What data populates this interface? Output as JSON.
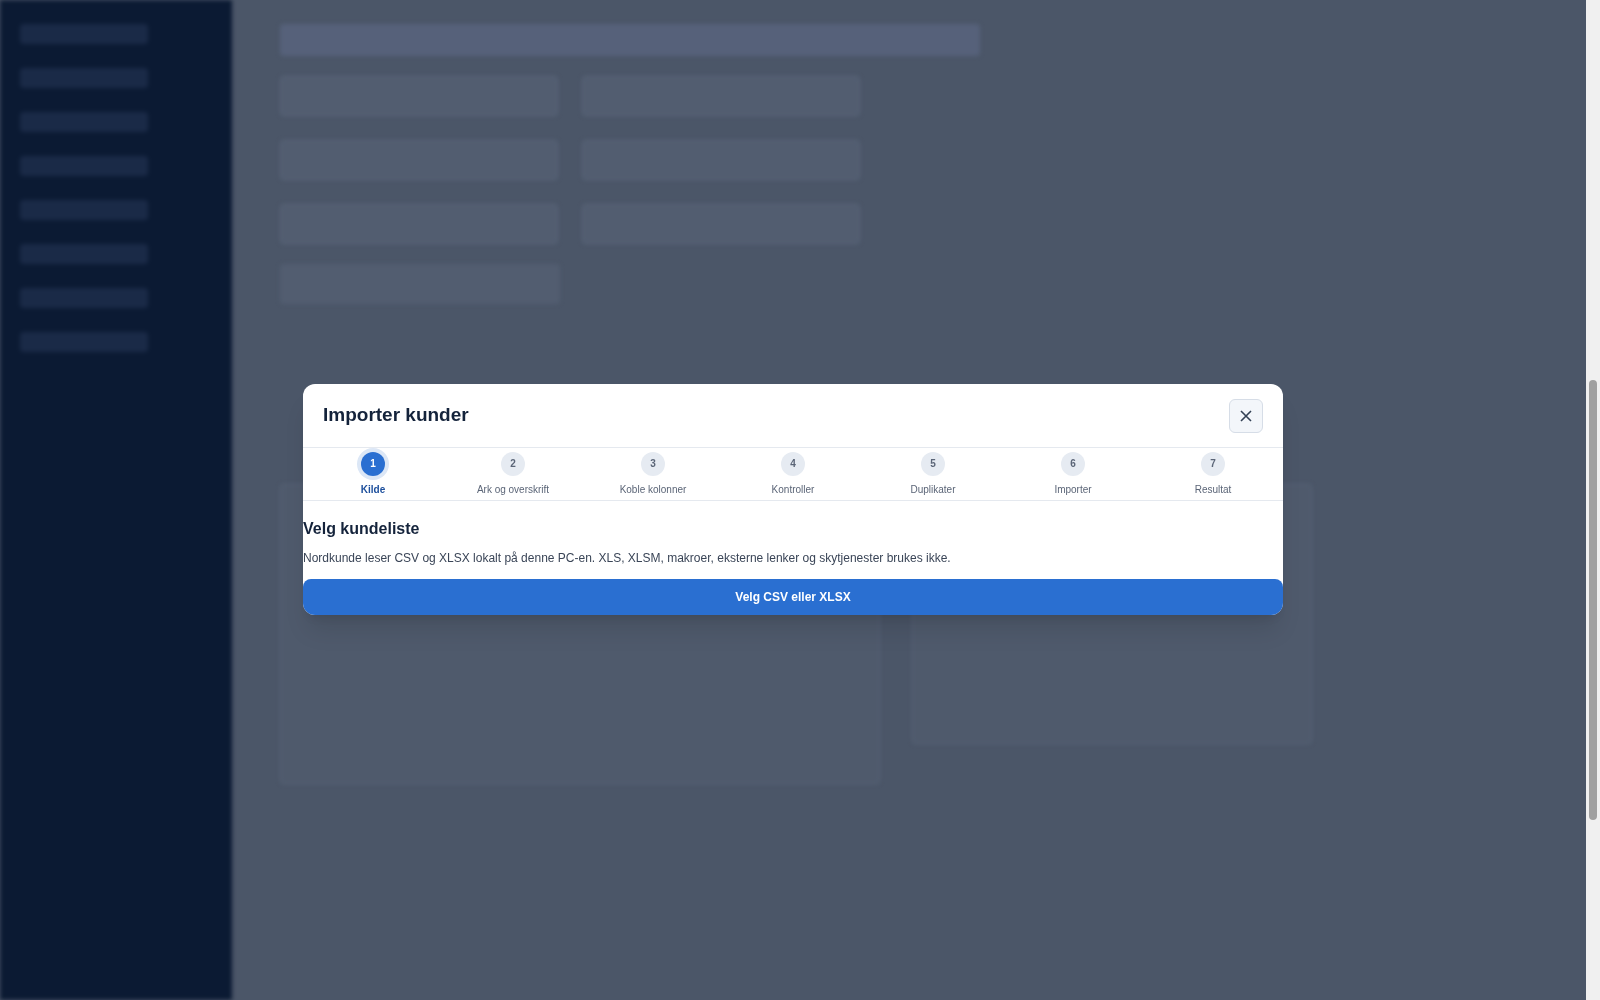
{
  "dialog": {
    "title": "Importer kunder",
    "steps": [
      {
        "number": "1",
        "label": "Kilde",
        "selected": true
      },
      {
        "number": "2",
        "label": "Ark og overskrift",
        "selected": false
      },
      {
        "number": "3",
        "label": "Koble kolonner",
        "selected": false
      },
      {
        "number": "4",
        "label": "Kontroller",
        "selected": false
      },
      {
        "number": "5",
        "label": "Duplikater",
        "selected": false
      },
      {
        "number": "6",
        "label": "Importer",
        "selected": false
      },
      {
        "number": "7",
        "label": "Resultat",
        "selected": false
      }
    ],
    "heading": "Velg kundeliste",
    "description": "Nordkunde leser CSV og XLSX lokalt på denne PC-en. XLS, XLSM, makroer, eksterne lenker og skytjenester brukes ikke.",
    "button": "Velg CSV eller XLSX"
  }
}
